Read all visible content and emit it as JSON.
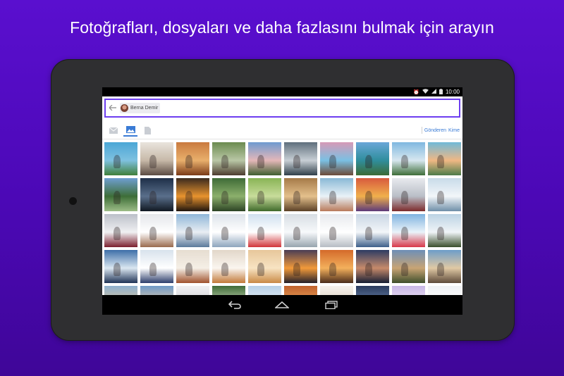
{
  "headline": "Fotoğrafları, dosyaları ve daha fazlasını bulmak için arayın",
  "status_bar": {
    "time": "10:00"
  },
  "search": {
    "chip_name": "Berna Demir"
  },
  "tabs": [
    {
      "icon": "mail-icon",
      "active": false
    },
    {
      "icon": "photo-icon",
      "active": true
    },
    {
      "icon": "document-icon",
      "active": false
    }
  ],
  "filters": {
    "sender": "Gönderen",
    "recipient": "Kime"
  },
  "colors": {
    "accent": "#6d3ef0",
    "link": "#3a7bd5",
    "background": "#5a0fcf",
    "bezel": "#2f2f31"
  },
  "photos": [
    [
      "#4aa6d6",
      "#7fc1e0",
      "#3f7f3a"
    ],
    [
      "#e9e4dd",
      "#c7b9a8",
      "#5b4b42"
    ],
    [
      "#c97a3f",
      "#e9b06c",
      "#7a3a18"
    ],
    [
      "#6b8b4f",
      "#b9c7a6",
      "#4c3b2f"
    ],
    [
      "#6e9ad0",
      "#e4b7b9",
      "#3f5f2f"
    ],
    [
      "#5f6f7d",
      "#c8cfd5",
      "#2f3f4a"
    ],
    [
      "#d79ab7",
      "#7ac0e3",
      "#6c4a38"
    ],
    [
      "#6aa7d8",
      "#2f8e9d",
      "#3c6b35"
    ],
    [
      "#7fb8e0",
      "#d7e7ef",
      "#3e6e39"
    ],
    [
      "#6fb9d8",
      "#f0b884",
      "#4d7c4a"
    ],
    [
      "#6f9ed1",
      "#3d6e37",
      "#9dbd88"
    ],
    [
      "#1e2f48",
      "#5a6f8b",
      "#101822"
    ],
    [
      "#3a2a1e",
      "#e8932e",
      "#1e140d"
    ],
    [
      "#3f6b37",
      "#8cb06c",
      "#2c4324"
    ],
    [
      "#89b456",
      "#c8dc9b",
      "#3f6a2b"
    ],
    [
      "#a57a48",
      "#e4c08c",
      "#5a4026"
    ],
    [
      "#8ab9d6",
      "#e9f2f7",
      "#b97a5a"
    ],
    [
      "#d85a3d",
      "#f0b04c",
      "#5d3a7a"
    ],
    [
      "#e8eaee",
      "#b9bec7",
      "#7d2b2b"
    ],
    [
      "#c8dbe9",
      "#f2f6f9",
      "#6f8fa8"
    ],
    [
      "#bcc0c9",
      "#f0f0f2",
      "#7b1f2e"
    ],
    [
      "#e4e6ea",
      "#ffffff",
      "#9a6a4d"
    ],
    [
      "#8fb6d8",
      "#e9eef3",
      "#5b7a9b"
    ],
    [
      "#dde3ea",
      "#ffffff",
      "#8ea5bd"
    ],
    [
      "#cfe0ef",
      "#ffffff",
      "#d1353a"
    ],
    [
      "#d7dde3",
      "#f7f9fb",
      "#98a5ae"
    ],
    [
      "#e7e9ed",
      "#ffffff",
      "#b6bcc4"
    ],
    [
      "#c9d6e4",
      "#f3f6f9",
      "#3d5f8a"
    ],
    [
      "#7fb3df",
      "#eaf3f9",
      "#d8394a"
    ],
    [
      "#bcd3e4",
      "#f0f4f7",
      "#3a4f2c"
    ],
    [
      "#3d6ea8",
      "#dbe7f1",
      "#1f3355"
    ],
    [
      "#d8e2ec",
      "#ffffff",
      "#2d3e6b"
    ],
    [
      "#e6ddd1",
      "#f5efe6",
      "#a0522d"
    ],
    [
      "#e2d7c9",
      "#faf5ef",
      "#c27a3a"
    ],
    [
      "#e7c79b",
      "#f7e3c2",
      "#c98a46"
    ],
    [
      "#4a3d55",
      "#f29a3a",
      "#24202b"
    ],
    [
      "#d46a2a",
      "#f3b05c",
      "#4a2c1b"
    ],
    [
      "#2d3c63",
      "#c78a6a",
      "#151d33"
    ],
    [
      "#6e8fb7",
      "#c8a474",
      "#3e4f2c"
    ],
    [
      "#6d9dc9",
      "#e0c9a4",
      "#5d4a3a"
    ],
    [
      "#8fb0cf",
      "#d9c69f",
      "#5c4d3b"
    ],
    [
      "#6f9ac7",
      "#e3c9a9",
      "#7c5f3f"
    ],
    [
      "#f0f0f2",
      "#d2d2d6",
      "#9c9ca2"
    ],
    [
      "#3f6b37",
      "#c5d4b6",
      "#2a3d24"
    ],
    [
      "#b8d0e6",
      "#e7eff6",
      "#7b8a9a"
    ],
    [
      "#c0622e",
      "#e9a35a",
      "#2d1d16"
    ],
    [
      "#f5f1ec",
      "#e0d4c4",
      "#a8987f"
    ],
    [
      "#2a3b5e",
      "#6a82a8",
      "#15203a"
    ],
    [
      "#c7b7e5",
      "#f2e7f7",
      "#5c4a86"
    ],
    [
      "#eef1f4",
      "#ffffff",
      "#c8ced6"
    ]
  ]
}
